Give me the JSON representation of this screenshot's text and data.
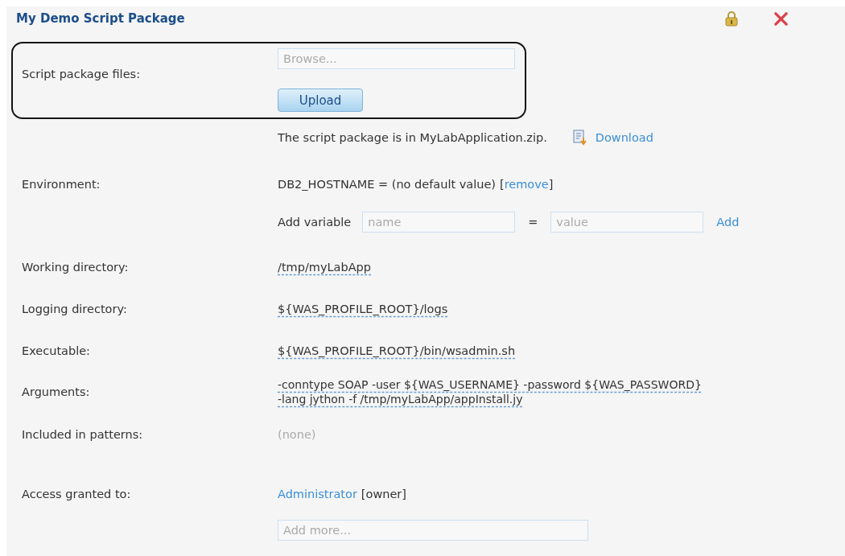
{
  "panel": {
    "title": "My Demo Script Package"
  },
  "upload": {
    "label": "Script package files:",
    "browse_placeholder": "Browse...",
    "button": "Upload"
  },
  "package_note": {
    "text": "The script package is in MyLabApplication.zip.",
    "link": "Download"
  },
  "environment": {
    "label": "Environment:",
    "variables": [
      {
        "text": "DB2_HOSTNAME = (no default value)",
        "open": "[",
        "action": "remove",
        "close": "]"
      }
    ],
    "add": {
      "label": "Add variable",
      "name_placeholder": "name",
      "equals": "=",
      "value_placeholder": "value",
      "button": "Add"
    }
  },
  "properties": [
    {
      "label": "Working directory:",
      "kind": "editable",
      "lines": [
        "/tmp/myLabApp"
      ]
    },
    {
      "label": "Logging directory:",
      "kind": "editable",
      "lines": [
        "${WAS_PROFILE_ROOT}/logs"
      ]
    },
    {
      "label": "Executable:",
      "kind": "editable",
      "lines": [
        "${WAS_PROFILE_ROOT}/bin/wsadmin.sh"
      ]
    },
    {
      "label": "Arguments:",
      "kind": "editable",
      "lines": [
        "-conntype SOAP -user ${WAS_USERNAME} -password ${WAS_PASSWORD}",
        "-lang jython -f /tmp/myLabApp/appInstall.jy"
      ]
    },
    {
      "label": "Included in patterns:",
      "kind": "muted",
      "lines": [
        "(none)"
      ]
    }
  ],
  "access": {
    "label": "Access granted to:",
    "users": [
      {
        "name": "Administrator",
        "role": "[owner]"
      }
    ],
    "add_placeholder": "Add more..."
  }
}
